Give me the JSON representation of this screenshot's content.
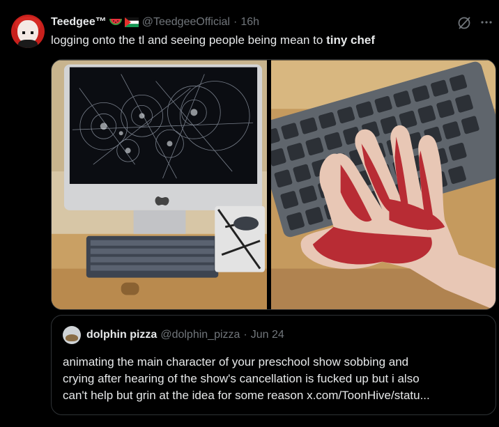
{
  "tweet": {
    "author_name": "Teedgee™",
    "emoji": [
      "watermelon-emoji",
      "palestine-flag-emoji"
    ],
    "handle": "@TeedgeeOfficial",
    "separator": "·",
    "time": "16h",
    "text_before": "logging onto the tl and seeing people being mean to ",
    "text_bold": "tiny chef"
  },
  "quote": {
    "author_name": "dolphin pizza",
    "handle": "@dolphin_pizza",
    "separator": "·",
    "date": "Jun 24",
    "lines": [
      "animating the main character of your preschool show sobbing and",
      "crying after hearing of the show's cancellation is fucked up but i also",
      "can't help but grin at the idea for some reason x.com/ToonHive/statu..."
    ]
  },
  "colors": {
    "background": "#000000",
    "text": "#e7e9ea",
    "secondary": "#71767b",
    "border": "#2f3336"
  }
}
